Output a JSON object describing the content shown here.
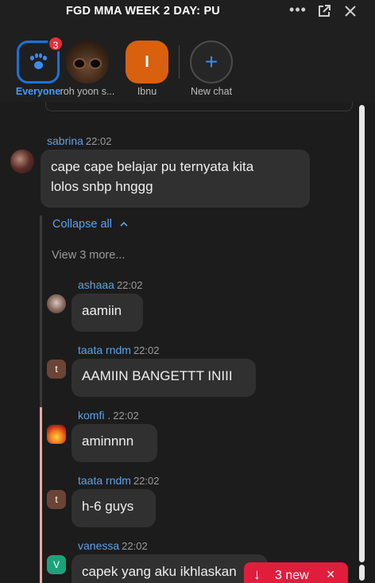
{
  "window": {
    "title": "FGD MMA WEEK 2 DAY: PU",
    "more_icon": "ellipsis-icon",
    "popout_icon": "popout-icon",
    "close_icon": "close-icon"
  },
  "participants": [
    {
      "name": "Everyone",
      "badge": "3",
      "icon": "paw-icon"
    },
    {
      "name": "roh yoon s..."
    },
    {
      "name": "Ibnu",
      "initial": "I"
    },
    {
      "name": "New chat",
      "icon": "plus-icon"
    }
  ],
  "messages": {
    "sabrina": {
      "sender": "sabrina",
      "time": "22:02",
      "text_line1": "cape cape belajar pu ternyata kita",
      "text_line2": "lolos snbp hnggg"
    },
    "collapse_label": "Collapse all",
    "view_more_label": "View 3 more...",
    "ashaaa": {
      "sender": "ashaaa",
      "time": "22:02",
      "text": "aamiin"
    },
    "taata1": {
      "sender": "taata rndm",
      "time": "22:02",
      "text": "AAMIIN BANGETTT INIII",
      "initial": "t"
    },
    "komfi": {
      "sender": "komfi .",
      "time": "22:02",
      "text": "aminnnn"
    },
    "taata2": {
      "sender": "taata rndm",
      "time": "22:02",
      "text": "h-6 guys",
      "initial": "t"
    },
    "vanessa": {
      "sender": "vanessa",
      "time": "22:02",
      "text": "capek yang aku ikhlaskan",
      "initial": "V"
    }
  },
  "new_messages": {
    "label": "3 new",
    "arrow": "↓",
    "close": "×"
  },
  "colors": {
    "accent": "#1a73d9",
    "sender": "#5aa3ea",
    "badge": "#e0303b",
    "new_pill": "#e01e3c"
  }
}
